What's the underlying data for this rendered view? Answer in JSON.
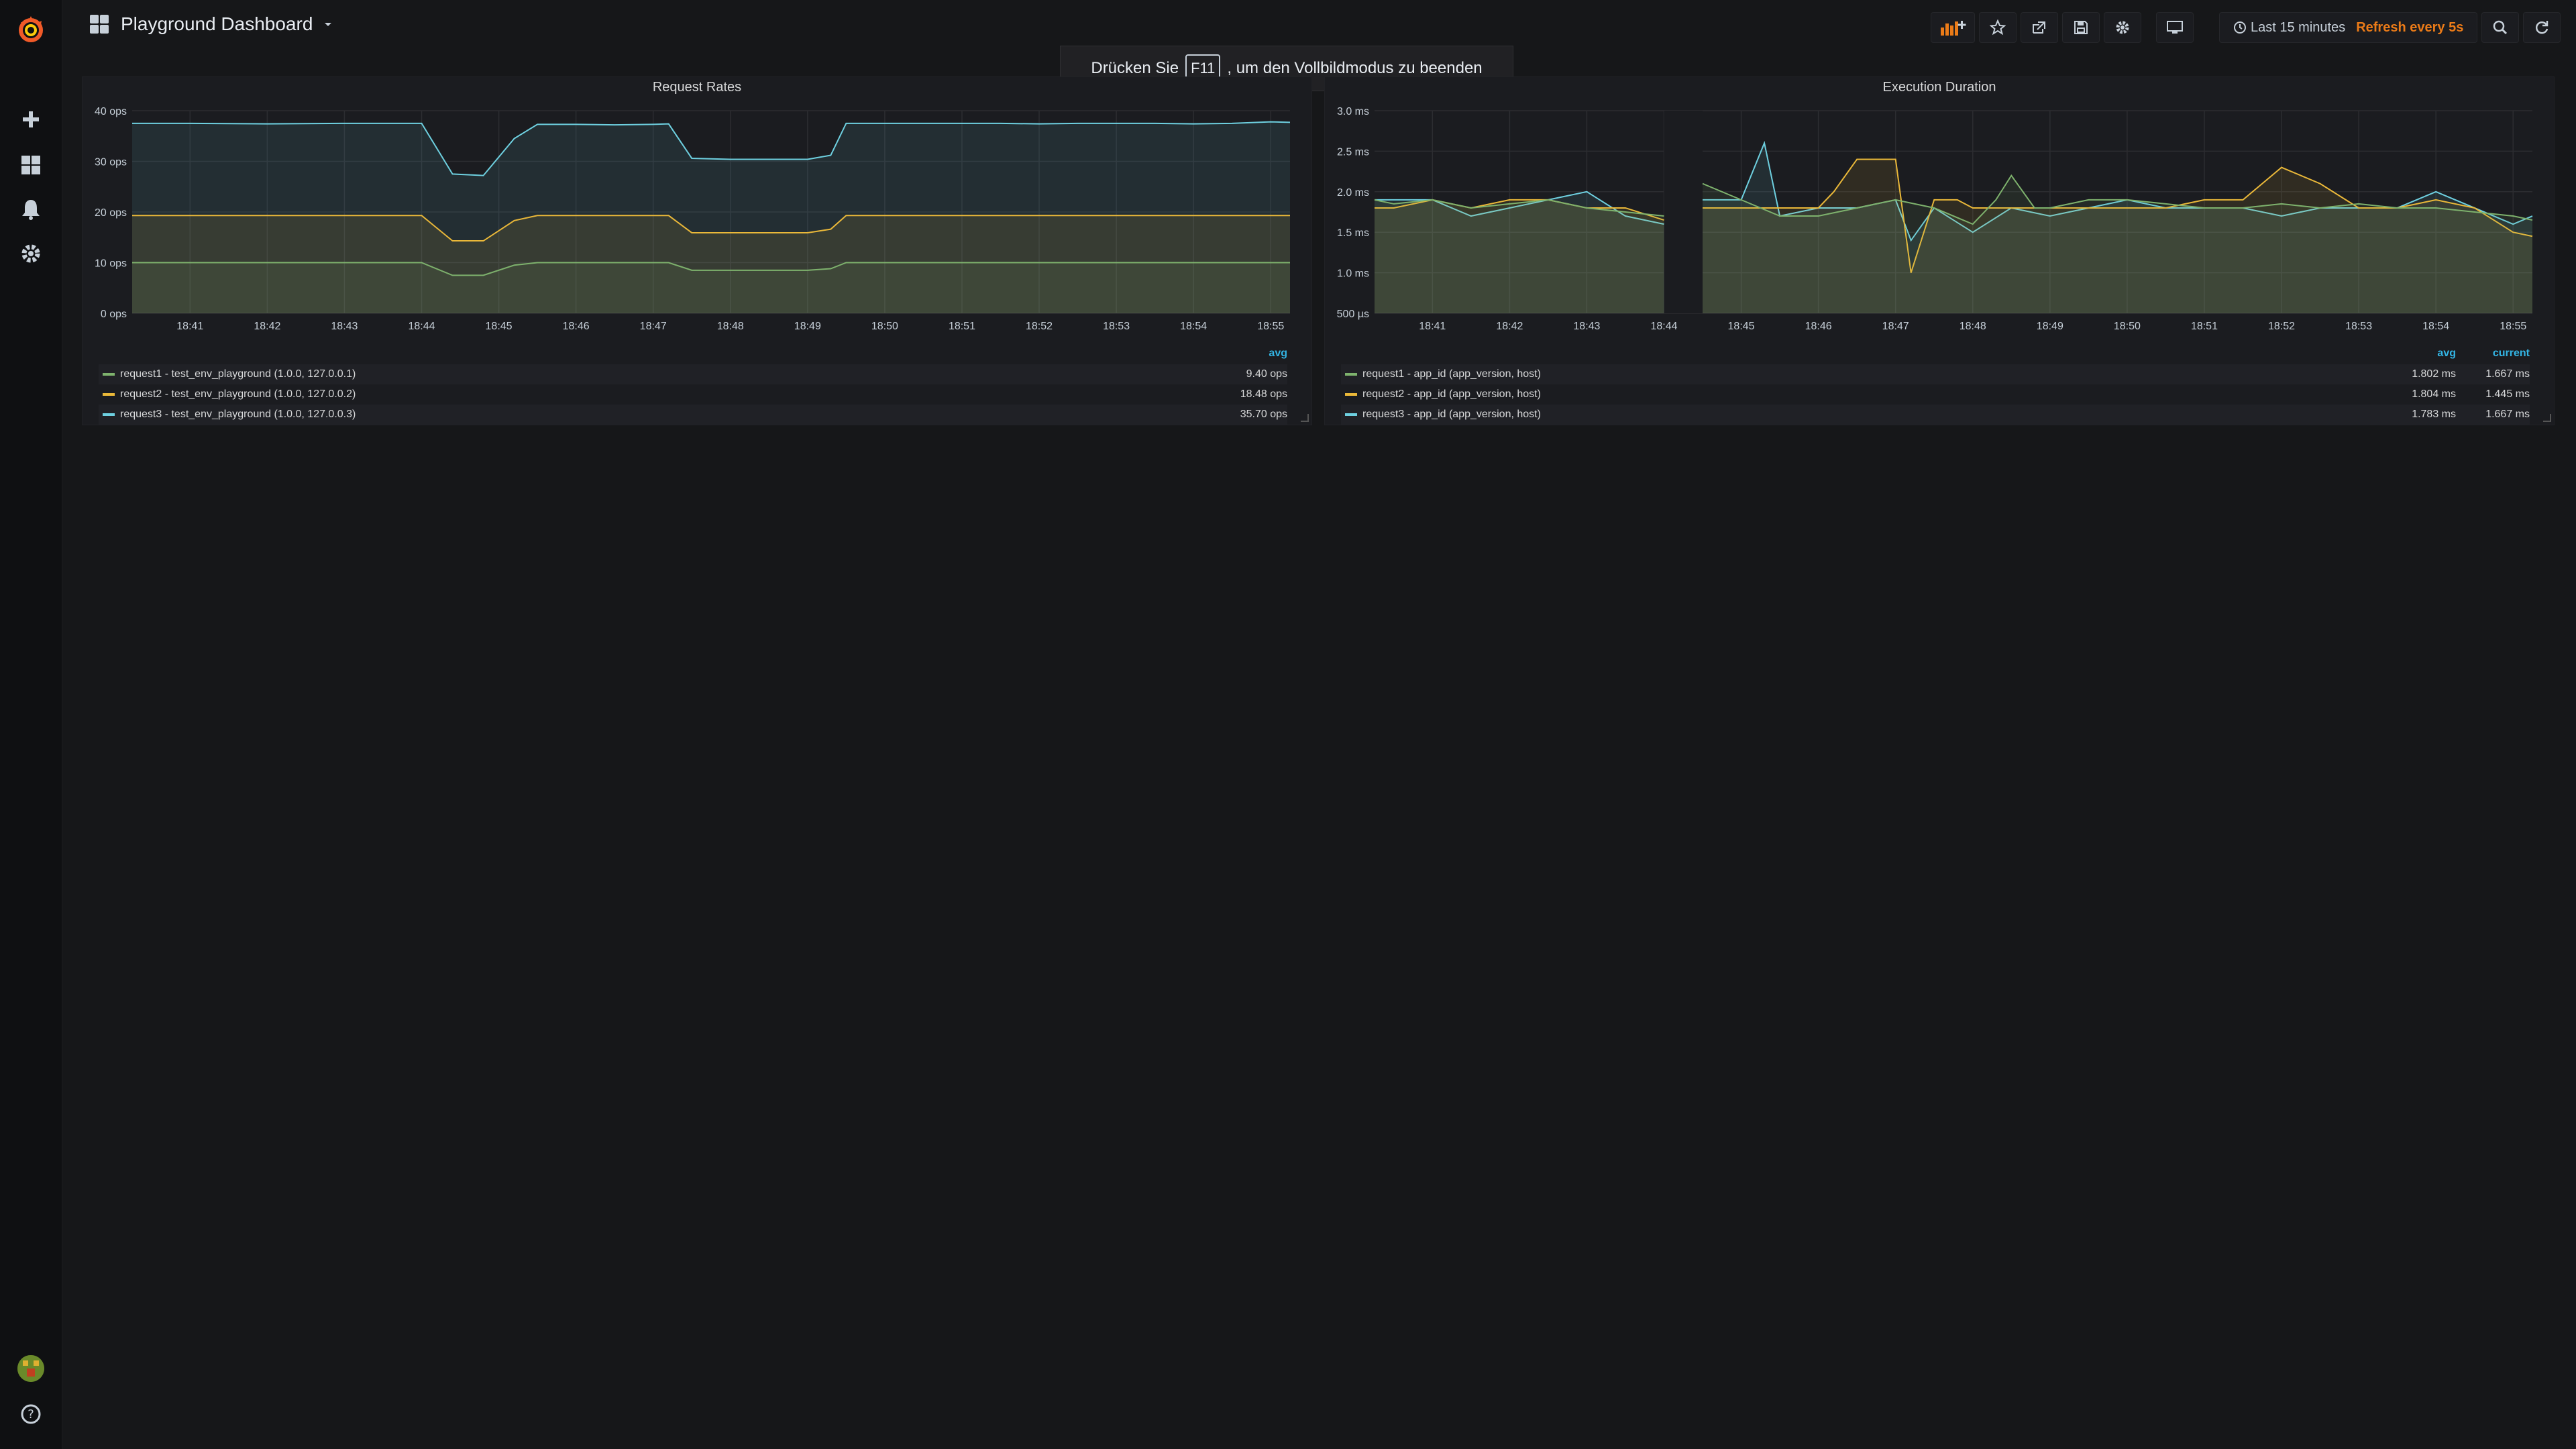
{
  "sidebar": {
    "items": [
      {
        "name": "add-icon"
      },
      {
        "name": "dashboards-icon"
      },
      {
        "name": "alerting-bell-icon"
      },
      {
        "name": "configuration-gear-icon"
      }
    ],
    "help_icon": "help-icon"
  },
  "header": {
    "title": "Playground Dashboard",
    "time_range": "Last 15 minutes",
    "refresh": "Refresh every 5s"
  },
  "toast": {
    "prefix": "Drücken Sie",
    "key": "F11",
    "suffix": ", um den Vollbildmodus zu beenden"
  },
  "colors": {
    "series1": "#7eb26d",
    "series2": "#eab839",
    "series3": "#6ed0e0",
    "accent": "#33b5e5",
    "refresh": "#eb7b18"
  },
  "panels": [
    {
      "title": "Request Rates",
      "legend_headers": [
        "avg"
      ],
      "legend": [
        {
          "name": "request1 - test_env_playground (1.0.0, 127.0.0.1)",
          "values": [
            "9.40 ops"
          ]
        },
        {
          "name": "request2 - test_env_playground (1.0.0, 127.0.0.2)",
          "values": [
            "18.48 ops"
          ]
        },
        {
          "name": "request3 - test_env_playground (1.0.0, 127.0.0.3)",
          "values": [
            "35.70 ops"
          ]
        }
      ]
    },
    {
      "title": "Execution Duration",
      "legend_headers": [
        "avg",
        "current"
      ],
      "legend": [
        {
          "name": "request1 - app_id (app_version, host)",
          "values": [
            "1.802 ms",
            "1.667 ms"
          ]
        },
        {
          "name": "request2 - app_id (app_version, host)",
          "values": [
            "1.804 ms",
            "1.445 ms"
          ]
        },
        {
          "name": "request3 - app_id (app_version, host)",
          "values": [
            "1.783 ms",
            "1.667 ms"
          ]
        }
      ]
    }
  ],
  "chart_data": [
    {
      "type": "line",
      "title": "Request Rates",
      "x_ticks": [
        "18:41",
        "18:42",
        "18:43",
        "18:44",
        "18:45",
        "18:46",
        "18:47",
        "18:48",
        "18:49",
        "18:50",
        "18:51",
        "18:52",
        "18:53",
        "18:54",
        "18:55"
      ],
      "y_ticks": [
        "0 ops",
        "10 ops",
        "20 ops",
        "30 ops",
        "40 ops"
      ],
      "ylim": [
        0,
        40
      ],
      "xlim": [
        40.25,
        55.25
      ],
      "stacked": true,
      "series": [
        {
          "name": "request1 - test_env_playground (1.0.0, 127.0.0.1)",
          "x": [
            40.25,
            41,
            42,
            43,
            44,
            44.4,
            44.8,
            45.2,
            45.5,
            46,
            46.5,
            47,
            47.2,
            47.5,
            48,
            48.5,
            48.8,
            49,
            49.3,
            49.5,
            50,
            50.5,
            51,
            51.5,
            52,
            52.5,
            53,
            53.5,
            54,
            54.5,
            55,
            55.25
          ],
          "values": [
            10,
            10,
            10,
            10,
            10,
            7.5,
            7.5,
            9.5,
            10,
            10,
            10,
            10,
            10,
            8.5,
            8.5,
            8.5,
            8.5,
            8.5,
            8.8,
            10,
            10,
            10,
            10,
            10,
            10,
            10,
            10,
            10,
            10,
            10,
            10,
            10
          ]
        },
        {
          "name": "request2 - test_env_playground (1.0.0, 127.0.0.2)",
          "x": [
            40.25,
            41,
            42,
            43,
            44,
            44.4,
            44.8,
            45.2,
            45.5,
            46,
            46.5,
            47,
            47.2,
            47.5,
            48,
            48.5,
            48.8,
            49,
            49.3,
            49.5,
            50,
            50.5,
            51,
            51.5,
            52,
            52.5,
            53,
            53.5,
            54,
            54.5,
            55,
            55.25
          ],
          "values": [
            19.3,
            19.3,
            19.3,
            19.3,
            19.3,
            14.3,
            14.3,
            18.3,
            19.3,
            19.3,
            19.3,
            19.3,
            19.3,
            15.9,
            15.9,
            15.9,
            15.9,
            15.9,
            16.6,
            19.3,
            19.3,
            19.3,
            19.3,
            19.3,
            19.3,
            19.3,
            19.3,
            19.3,
            19.3,
            19.3,
            19.3,
            19.3
          ]
        },
        {
          "name": "request3 - test_env_playground (1.0.0, 127.0.0.3)",
          "x": [
            40.25,
            41,
            42,
            43,
            44,
            44.4,
            44.8,
            45.2,
            45.5,
            46,
            46.5,
            47,
            47.2,
            47.5,
            48,
            48.5,
            48.8,
            49,
            49.3,
            49.5,
            50,
            50.5,
            51,
            51.5,
            52,
            52.5,
            53,
            53.5,
            54,
            54.5,
            55,
            55.25
          ],
          "values": [
            37.5,
            37.5,
            37.4,
            37.5,
            37.5,
            27.5,
            27.2,
            34.5,
            37.3,
            37.3,
            37.2,
            37.3,
            37.4,
            30.6,
            30.4,
            30.4,
            30.4,
            30.4,
            31.2,
            37.5,
            37.5,
            37.5,
            37.5,
            37.5,
            37.4,
            37.5,
            37.5,
            37.5,
            37.4,
            37.5,
            37.8,
            37.7
          ]
        }
      ]
    },
    {
      "type": "line",
      "title": "Execution Duration",
      "x_ticks": [
        "18:41",
        "18:42",
        "18:43",
        "18:44",
        "18:45",
        "18:46",
        "18:47",
        "18:48",
        "18:49",
        "18:50",
        "18:51",
        "18:52",
        "18:53",
        "18:54",
        "18:55"
      ],
      "y_ticks": [
        "500 µs",
        "1.0 ms",
        "1.5 ms",
        "2.0 ms",
        "2.5 ms",
        "3.0 ms"
      ],
      "ylim": [
        0.5,
        3.0
      ],
      "xlim": [
        40.25,
        55.25
      ],
      "gap": [
        44.0,
        44.5
      ],
      "series": [
        {
          "name": "request1 - app_id (app_version, host)",
          "x": [
            40.25,
            40.5,
            41,
            41.5,
            42,
            42.5,
            43,
            43.5,
            44,
            44.5,
            45,
            45.5,
            46,
            46.5,
            47,
            47.5,
            48,
            48.3,
            48.5,
            48.8,
            49,
            49.5,
            50,
            50.5,
            51,
            51.5,
            52,
            52.5,
            53,
            53.5,
            54,
            54.5,
            55,
            55.25
          ],
          "values": [
            1.9,
            1.85,
            1.9,
            1.8,
            1.85,
            1.9,
            1.8,
            1.75,
            1.7,
            2.1,
            1.9,
            1.7,
            1.7,
            1.8,
            1.9,
            1.8,
            1.6,
            1.9,
            2.2,
            1.8,
            1.8,
            1.9,
            1.9,
            1.85,
            1.8,
            1.8,
            1.85,
            1.8,
            1.85,
            1.8,
            1.8,
            1.75,
            1.7,
            1.65
          ]
        },
        {
          "name": "request2 - app_id (app_version, host)",
          "x": [
            40.25,
            40.5,
            41,
            41.5,
            42,
            42.5,
            43,
            43.5,
            44,
            44.5,
            45,
            45.5,
            46,
            46.2,
            46.5,
            47,
            47.2,
            47.5,
            47.8,
            48,
            48.5,
            49,
            49.5,
            50,
            50.5,
            51,
            51.5,
            52,
            52.5,
            53,
            53.5,
            54,
            54.5,
            55,
            55.25
          ],
          "values": [
            1.8,
            1.8,
            1.9,
            1.8,
            1.9,
            1.9,
            1.8,
            1.8,
            1.65,
            1.8,
            1.8,
            1.8,
            1.8,
            2.0,
            2.4,
            2.4,
            1.0,
            1.9,
            1.9,
            1.8,
            1.8,
            1.8,
            1.8,
            1.8,
            1.8,
            1.9,
            1.9,
            2.3,
            2.1,
            1.8,
            1.8,
            1.9,
            1.8,
            1.5,
            1.45
          ]
        },
        {
          "name": "request3 - app_id (app_version, host)",
          "x": [
            40.25,
            40.5,
            41,
            41.5,
            42,
            42.5,
            43,
            43.5,
            44,
            44.5,
            45,
            45.3,
            45.5,
            46,
            46.5,
            47,
            47.2,
            47.5,
            48,
            48.5,
            49,
            49.5,
            50,
            50.5,
            51,
            51.5,
            52,
            52.5,
            53,
            53.5,
            54,
            54.5,
            55,
            55.25
          ],
          "values": [
            1.9,
            1.9,
            1.9,
            1.7,
            1.8,
            1.9,
            2.0,
            1.7,
            1.6,
            1.9,
            1.9,
            2.6,
            1.7,
            1.8,
            1.8,
            1.9,
            1.4,
            1.8,
            1.5,
            1.8,
            1.7,
            1.8,
            1.9,
            1.8,
            1.8,
            1.8,
            1.7,
            1.8,
            1.8,
            1.8,
            2.0,
            1.8,
            1.6,
            1.7
          ]
        }
      ]
    }
  ]
}
